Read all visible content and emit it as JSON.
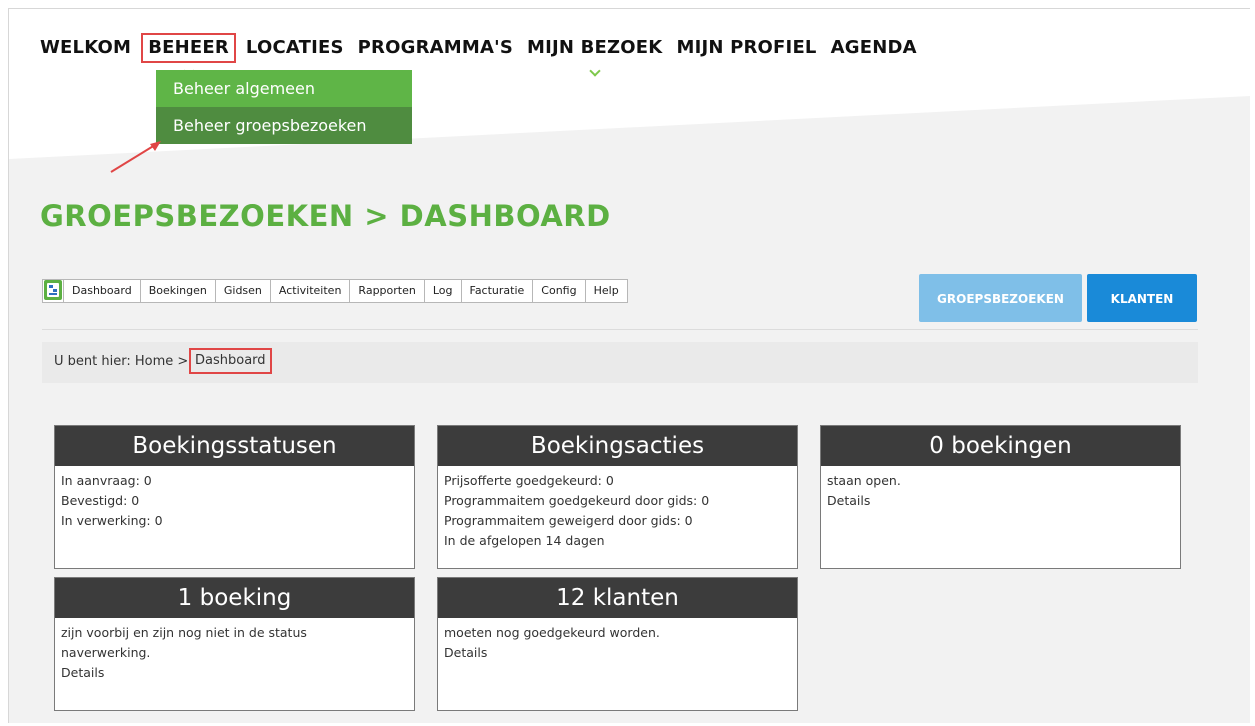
{
  "nav": {
    "items": [
      "WELKOM",
      "BEHEER",
      "LOCATIES",
      "PROGRAMMA'S",
      "MIJN BEZOEK",
      "MIJN PROFIEL",
      "AGENDA"
    ]
  },
  "dropdown": {
    "items": [
      "Beheer algemeen",
      "Beheer groepsbezoeken"
    ]
  },
  "page_title": "GROEPSBEZOEKEN > DASHBOARD",
  "subnav": {
    "items": [
      "Dashboard",
      "Boekingen",
      "Gidsen",
      "Activiteiten",
      "Rapporten",
      "Log",
      "Facturatie",
      "Config",
      "Help"
    ]
  },
  "buttons": {
    "groepsbezoeken": "GROEPSBEZOEKEN",
    "klanten": "KLANTEN"
  },
  "breadcrumb": {
    "prefix": "U bent hier: Home >",
    "current": "Dashboard"
  },
  "cards": [
    {
      "title": "Boekingsstatusen",
      "lines": [
        "In aanvraag: 0",
        "Bevestigd: 0",
        "In verwerking: 0"
      ]
    },
    {
      "title": "Boekingsacties",
      "lines": [
        "Prijsofferte goedgekeurd: 0",
        "Programmaitem goedgekeurd door gids: 0",
        "Programmaitem geweigerd door gids: 0",
        "In de afgelopen 14 dagen"
      ]
    },
    {
      "title": "0 boekingen",
      "lines": [
        "staan open.",
        "Details"
      ]
    },
    {
      "title": "1 boeking",
      "lines": [
        "zijn voorbij en zijn nog niet in de status",
        "naverwerking.",
        "Details"
      ]
    },
    {
      "title": "12 klanten",
      "lines": [
        "moeten nog goedgekeurd worden.",
        "Details"
      ]
    }
  ],
  "colors": {
    "accent_green": "#5cb042",
    "highlight_red": "#e04646",
    "primary_blue": "#1a8ad8",
    "card_header": "#3c3c3c"
  }
}
